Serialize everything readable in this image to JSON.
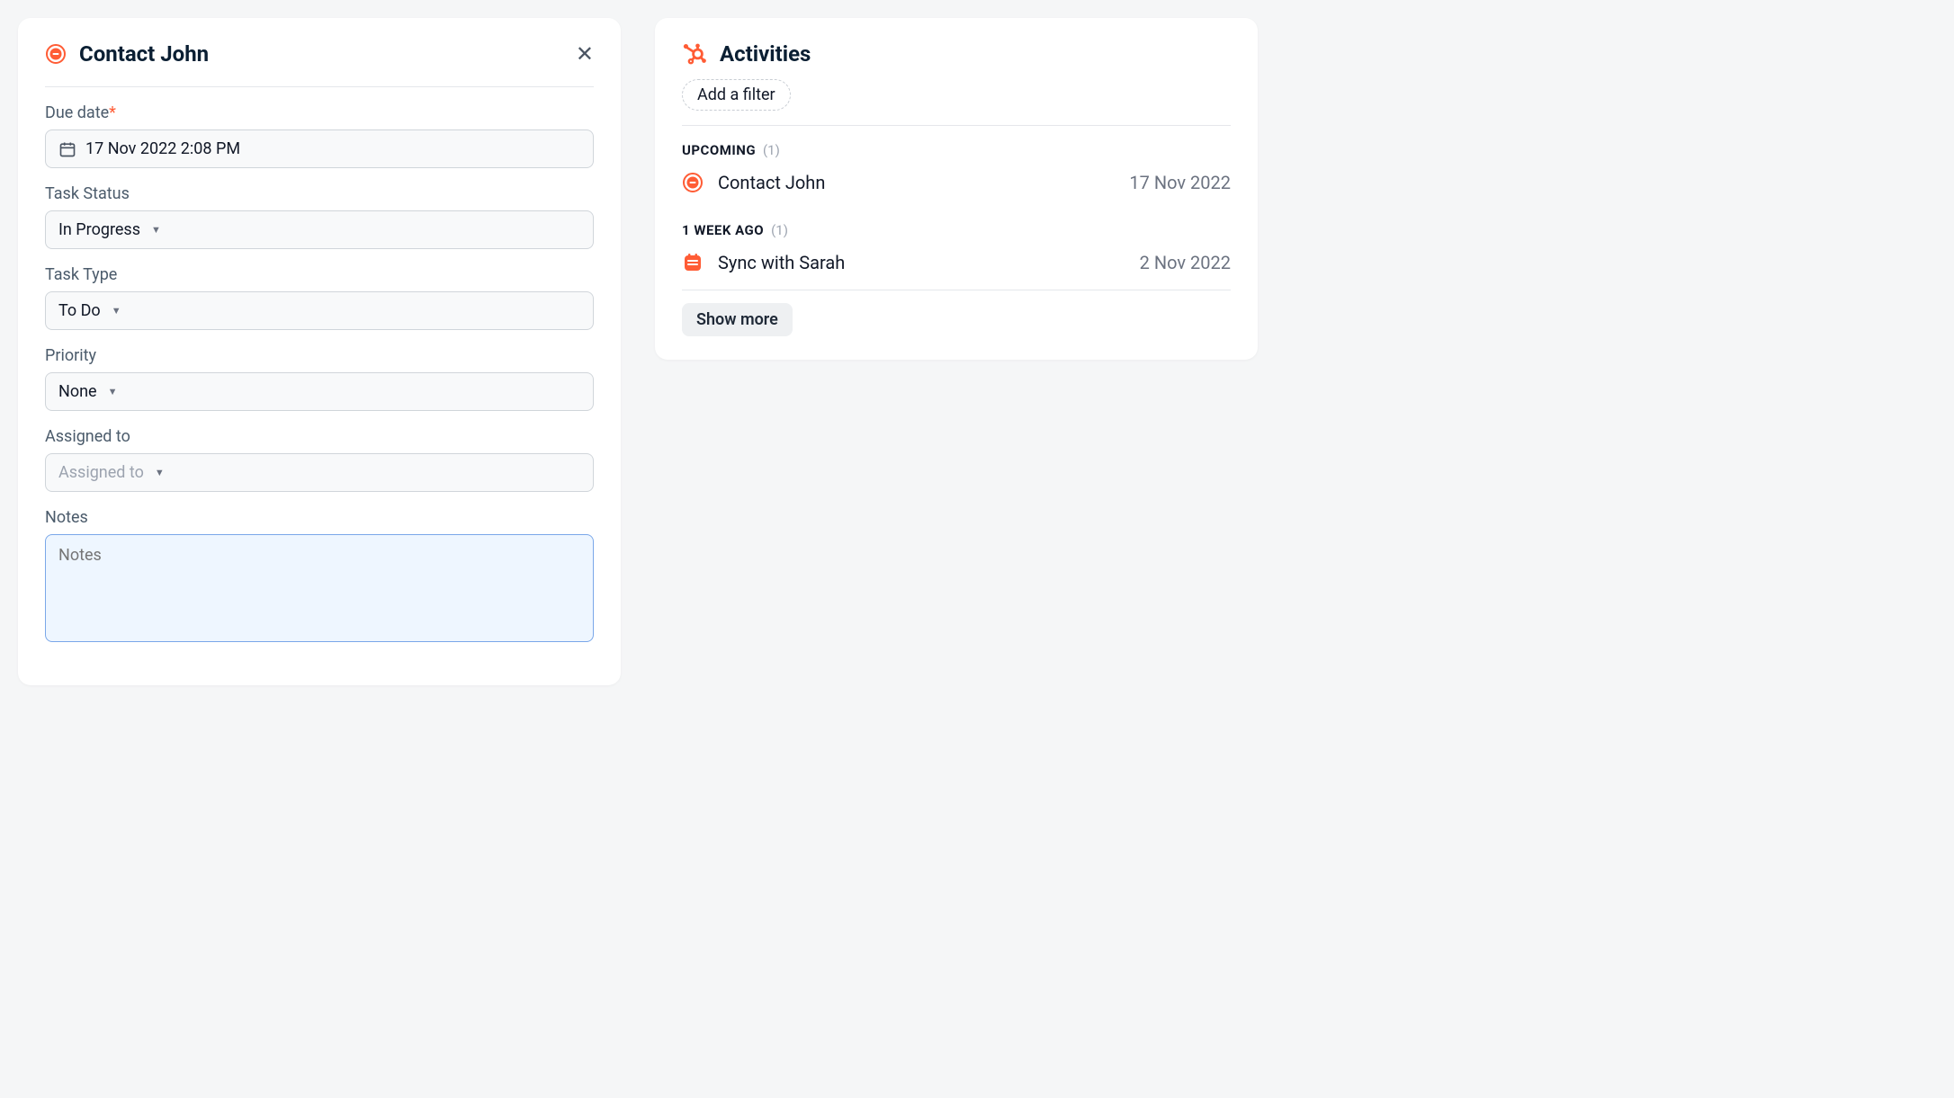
{
  "colors": {
    "accent": "#ff5c35"
  },
  "task_panel": {
    "title": "Contact John",
    "fields": {
      "due_date": {
        "label": "Due date",
        "required": true,
        "value": "17 Nov 2022 2:08 PM"
      },
      "task_status": {
        "label": "Task Status",
        "value": "In Progress"
      },
      "task_type": {
        "label": "Task Type",
        "value": "To Do"
      },
      "priority": {
        "label": "Priority",
        "value": "None"
      },
      "assigned_to": {
        "label": "Assigned to",
        "placeholder": "Assigned to"
      },
      "notes": {
        "label": "Notes",
        "placeholder": "Notes"
      }
    }
  },
  "activities_panel": {
    "title": "Activities",
    "add_filter_label": "Add a filter",
    "sections": [
      {
        "label": "UPCOMING",
        "count": "(1)",
        "items": [
          {
            "icon": "task-circle",
            "title": "Contact John",
            "date": "17 Nov 2022"
          }
        ]
      },
      {
        "label": "1 WEEK AGO",
        "count": "(1)",
        "items": [
          {
            "icon": "meeting-calendar",
            "title": "Sync with Sarah",
            "date": "2 Nov 2022"
          }
        ]
      }
    ],
    "show_more_label": "Show more"
  }
}
